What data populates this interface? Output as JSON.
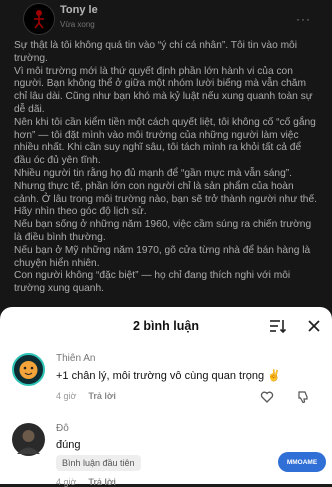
{
  "post": {
    "author": "Tony le",
    "time": "Vừa xong",
    "more": "···",
    "paragraphs": [
      "Sự thật là tôi không quá tin vào “ý chí cá nhân”. Tôi tin vào môi trường.",
      "Vì môi trường mới là thứ quyết định phần lớn hành vi của con người. Bạn không thể ở giữa một nhóm lười biếng mà vẫn chăm chỉ lâu dài. Cũng như bạn khó mà kỷ luật nếu xung quanh toàn sự dễ dãi.",
      "Nên khi tôi cần kiểm tiền một cách quyết liệt, tôi không cố “cố gắng hơn” — tôi đặt mình vào môi trường của những người làm việc nhiều nhất. Khi cần suy nghĩ sâu, tôi tách mình ra khỏi tất cả để đầu óc đủ yên tĩnh.",
      "Nhiều người tin rằng họ đủ mạnh để “gần mực mà vẫn sáng”. Nhưng thực tế, phần lớn con người chỉ là sản phẩm của hoàn cảnh. Ở lâu trong môi trường nào, bạn sẽ trở thành người như thế.",
      "Hãy nhìn theo góc độ lịch sử.",
      "Nếu bạn sống ở những năm 1960, việc cầm súng ra chiến trường là điều bình thường.",
      "Nếu bạn ở Mỹ những năm 1970, gõ cửa từng nhà để bán hàng là chuyện hiển nhiên.",
      "Con người không “đặc biệt” — họ chỉ đang thích nghi với môi trường xung quanh."
    ]
  },
  "sheet": {
    "title": "2 bình luận",
    "comments": [
      {
        "name": "Thiên An",
        "text": "+1 chân lý, môi trường vô cùng quan trọng ✌",
        "time": "4 giờ",
        "reply": "Trả lời"
      },
      {
        "name": "Đô",
        "text": "đúng",
        "time": "4 giờ",
        "reply": "Trả lời",
        "tag": "Bình luận đầu tiên"
      }
    ]
  },
  "badge": {
    "text": "MMOAME"
  }
}
